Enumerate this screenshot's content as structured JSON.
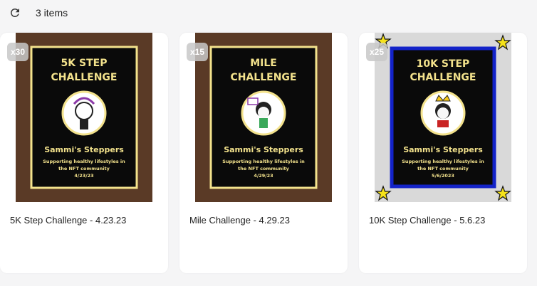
{
  "header": {
    "refresh_icon": "refresh-icon",
    "items_count": "3 items"
  },
  "colors": {
    "brown_bg": "#5a3a26",
    "poster_black": "#0a0a0a",
    "gold": "#f3e28c",
    "blue_frame": "#1323c9",
    "grey_bg": "#d9d9d9",
    "star_yellow": "#f5e21a"
  },
  "items": [
    {
      "quantity": "x30",
      "title": "5K Step Challenge - 4.23.23",
      "poster": {
        "line1": "5K STEP",
        "line2": "CHALLENGE",
        "team": "Sammi's Steppers",
        "tagline1": "Supporting healthy lifestyles in",
        "tagline2": "the NFT community",
        "date": "4/23/23"
      }
    },
    {
      "quantity": "x15",
      "title": "Mile Challenge - 4.29.23",
      "poster": {
        "line1": "MILE",
        "line2": "CHALLENGE",
        "team": "Sammi's Steppers",
        "tagline1": "Supporting healthy lifestyles in",
        "tagline2": "the NFT community",
        "date": "4/29/23"
      }
    },
    {
      "quantity": "x25",
      "title": "10K Step Challenge - 5.6.23",
      "poster": {
        "line1": "10K STEP",
        "line2": "CHALLENGE",
        "team": "Sammi's Steppers",
        "tagline1": "Supporting healthy lifestyles in",
        "tagline2": "the NFT community",
        "date": "5/6/2023"
      }
    }
  ]
}
